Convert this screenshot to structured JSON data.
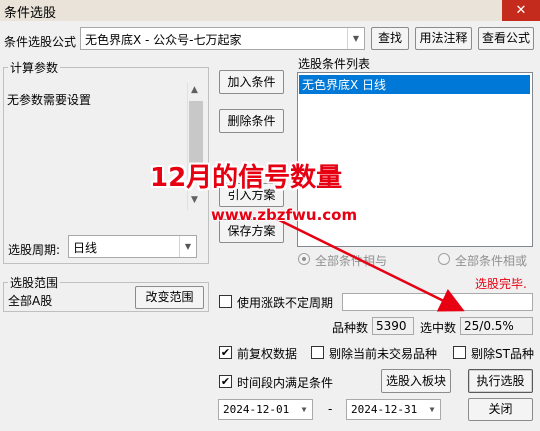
{
  "window": {
    "title": "条件选股",
    "close_glyph": "✕"
  },
  "formula_row": {
    "label": "条件选股公式",
    "selected": "无色界底X  -  公众号-七万起家",
    "buttons": {
      "find": "查找",
      "usage": "用法注释",
      "view": "查看公式"
    }
  },
  "params_group": {
    "legend": "计算参数",
    "text": "无参数需要设置",
    "period_label": "选股周期:",
    "period_value": "日线"
  },
  "middle_buttons": {
    "add": "加入条件",
    "delete": "删除条件",
    "import": "引入方案",
    "save": "保存方案"
  },
  "condition_list": {
    "label": "选股条件列表",
    "items": [
      "无色界底X  日线"
    ]
  },
  "logic": {
    "and_label": "全部条件相与",
    "or_label": "全部条件相或"
  },
  "status": {
    "text": "选股完毕.",
    "color": "#e60012"
  },
  "range_group": {
    "legend": "选股范围",
    "text": "全部A股",
    "change_button": "改变范围"
  },
  "options": {
    "use_period_label": "使用涨跌不定周期",
    "count_label": "品种数",
    "count_value": "5390",
    "selected_label": "选中数",
    "selected_value": "25/0.5%",
    "adjust_label": "前复权数据",
    "exclude_untraded_label": "剔除当前未交易品种",
    "exclude_st_label": "剔除ST品种",
    "time_range_label": "时间段内满足条件",
    "to_block_button": "选股入板块",
    "execute_button": "执行选股",
    "date_from": "2024-12-01",
    "date_sep": "-",
    "date_to": "2024-12-31",
    "close_button": "关闭"
  },
  "overlay": {
    "caption": "12月的信号数量",
    "url": "www.zbzfwu.com",
    "color": "#e60012"
  }
}
